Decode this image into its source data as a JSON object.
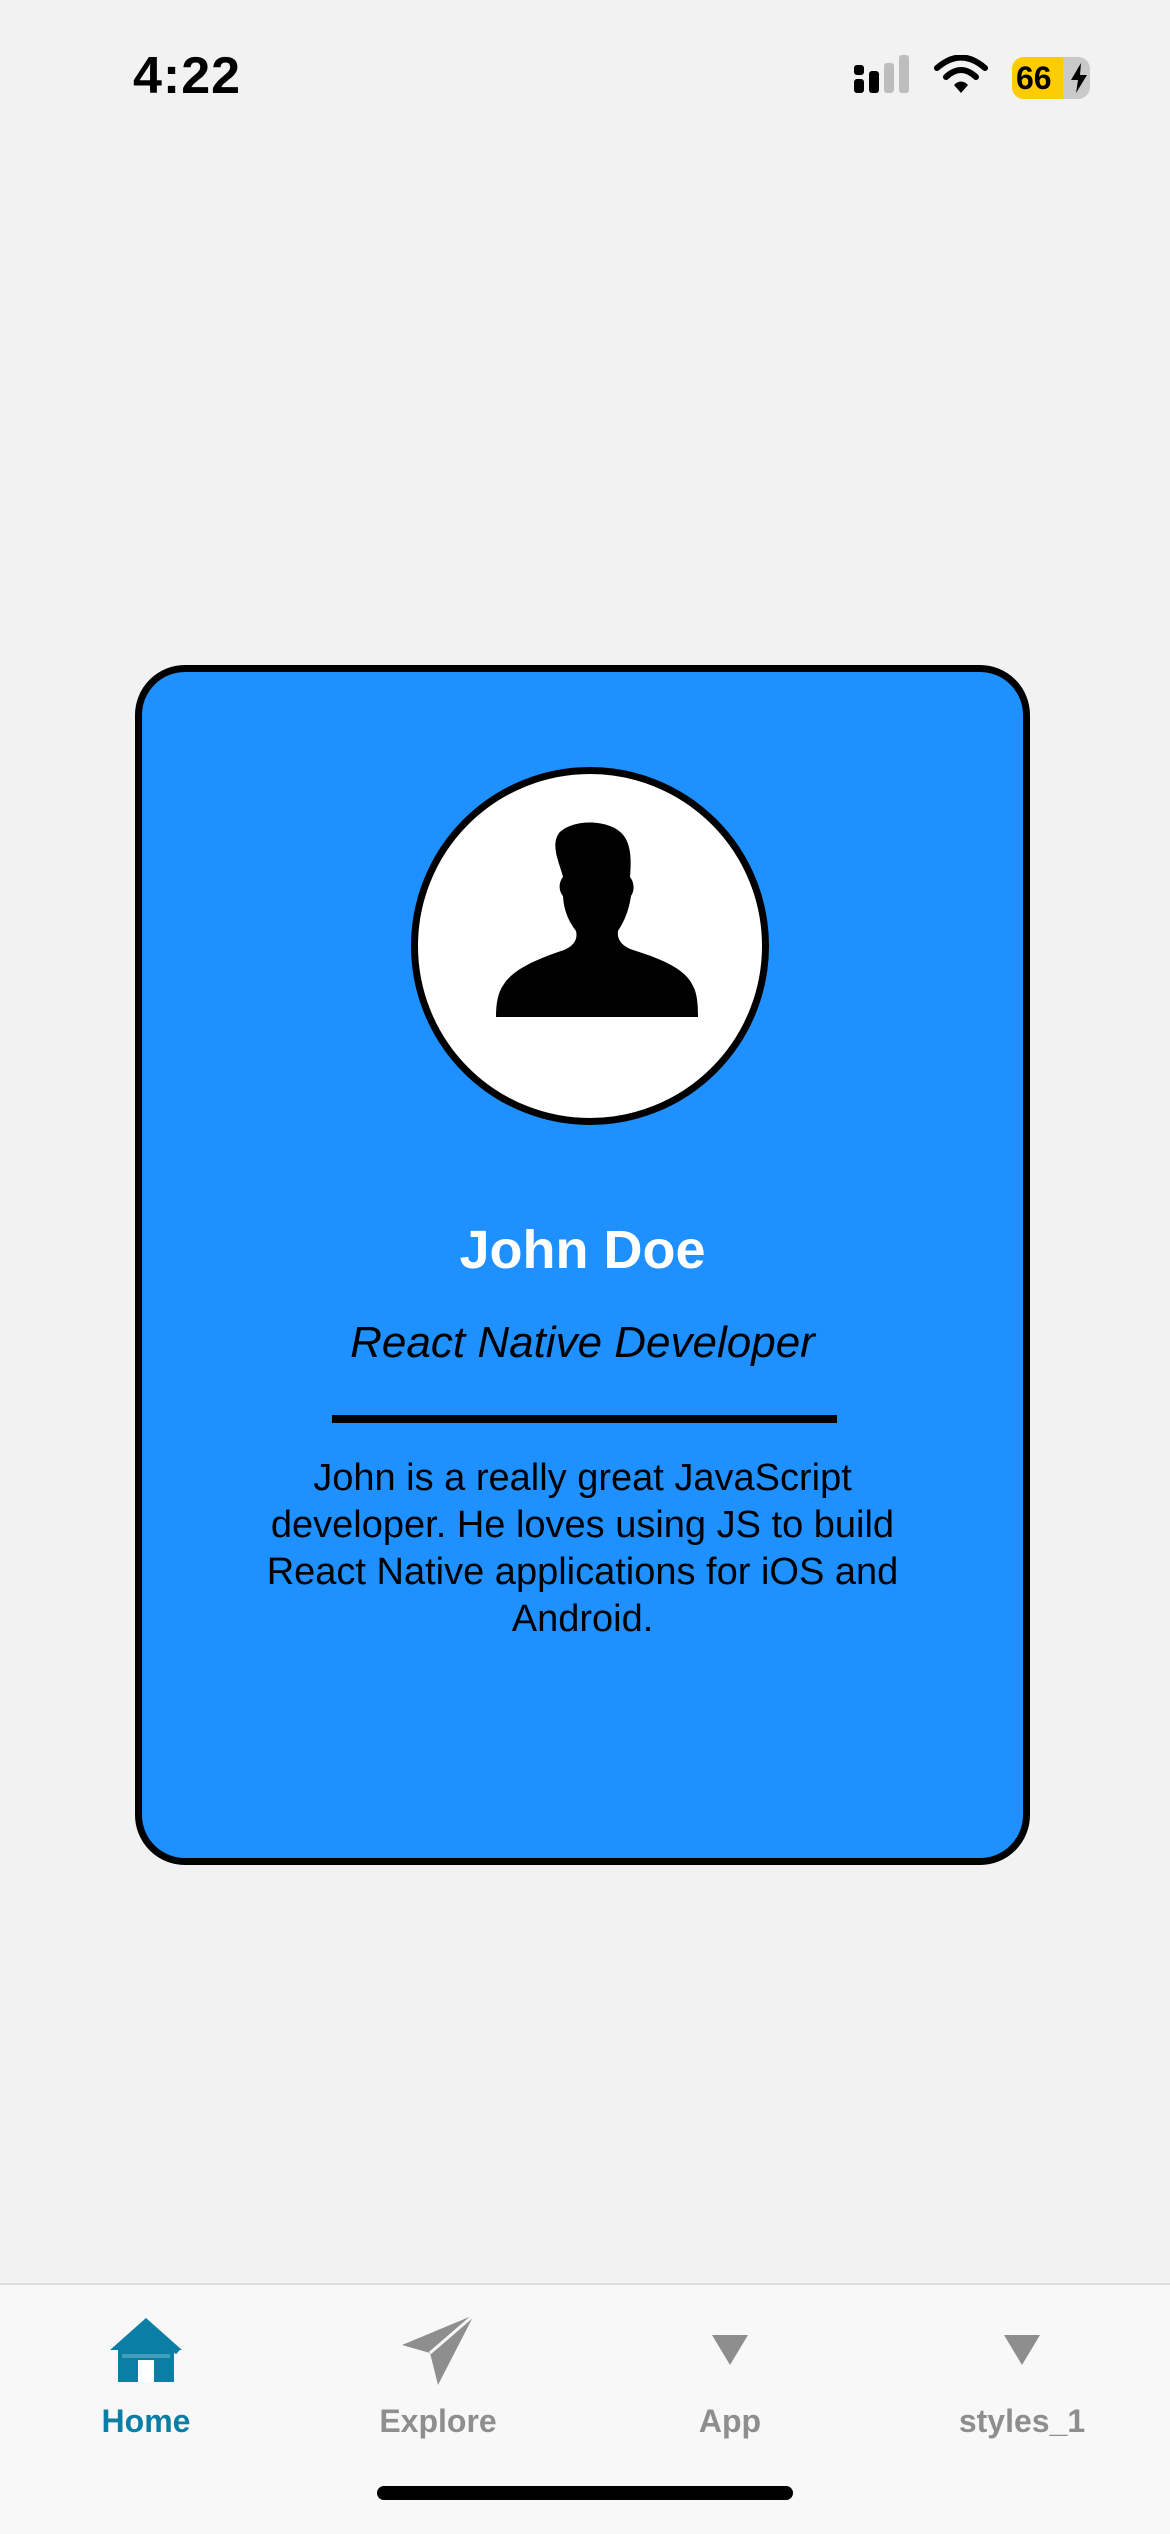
{
  "status_bar": {
    "time": "4:22",
    "battery_level": "66",
    "battery_fraction": 0.66,
    "icons": [
      "signal-icon",
      "wifi-icon",
      "battery-charging-icon"
    ]
  },
  "profile": {
    "name": "John Doe",
    "role": "React Native Developer",
    "bio": "John is a really great JavaScript developer. He loves using JS to build React Native applications for iOS and Android.",
    "avatar_icon": "person-silhouette-icon"
  },
  "tabs": [
    {
      "label": "Home",
      "icon": "house-icon",
      "active": true
    },
    {
      "label": "Explore",
      "icon": "paper-plane-icon",
      "active": false
    },
    {
      "label": "App",
      "icon": "triangle-down-icon",
      "active": false
    },
    {
      "label": "styles_1",
      "icon": "triangle-down-icon",
      "active": false
    }
  ],
  "colors": {
    "background": "#f2f2f2",
    "card": "#1e90ff",
    "card_border": "#000000",
    "name_text": "#ffffff",
    "tab_active": "#0a7ea4",
    "tab_inactive": "#8e8e8e",
    "battery_fill": "#ffcc00"
  }
}
